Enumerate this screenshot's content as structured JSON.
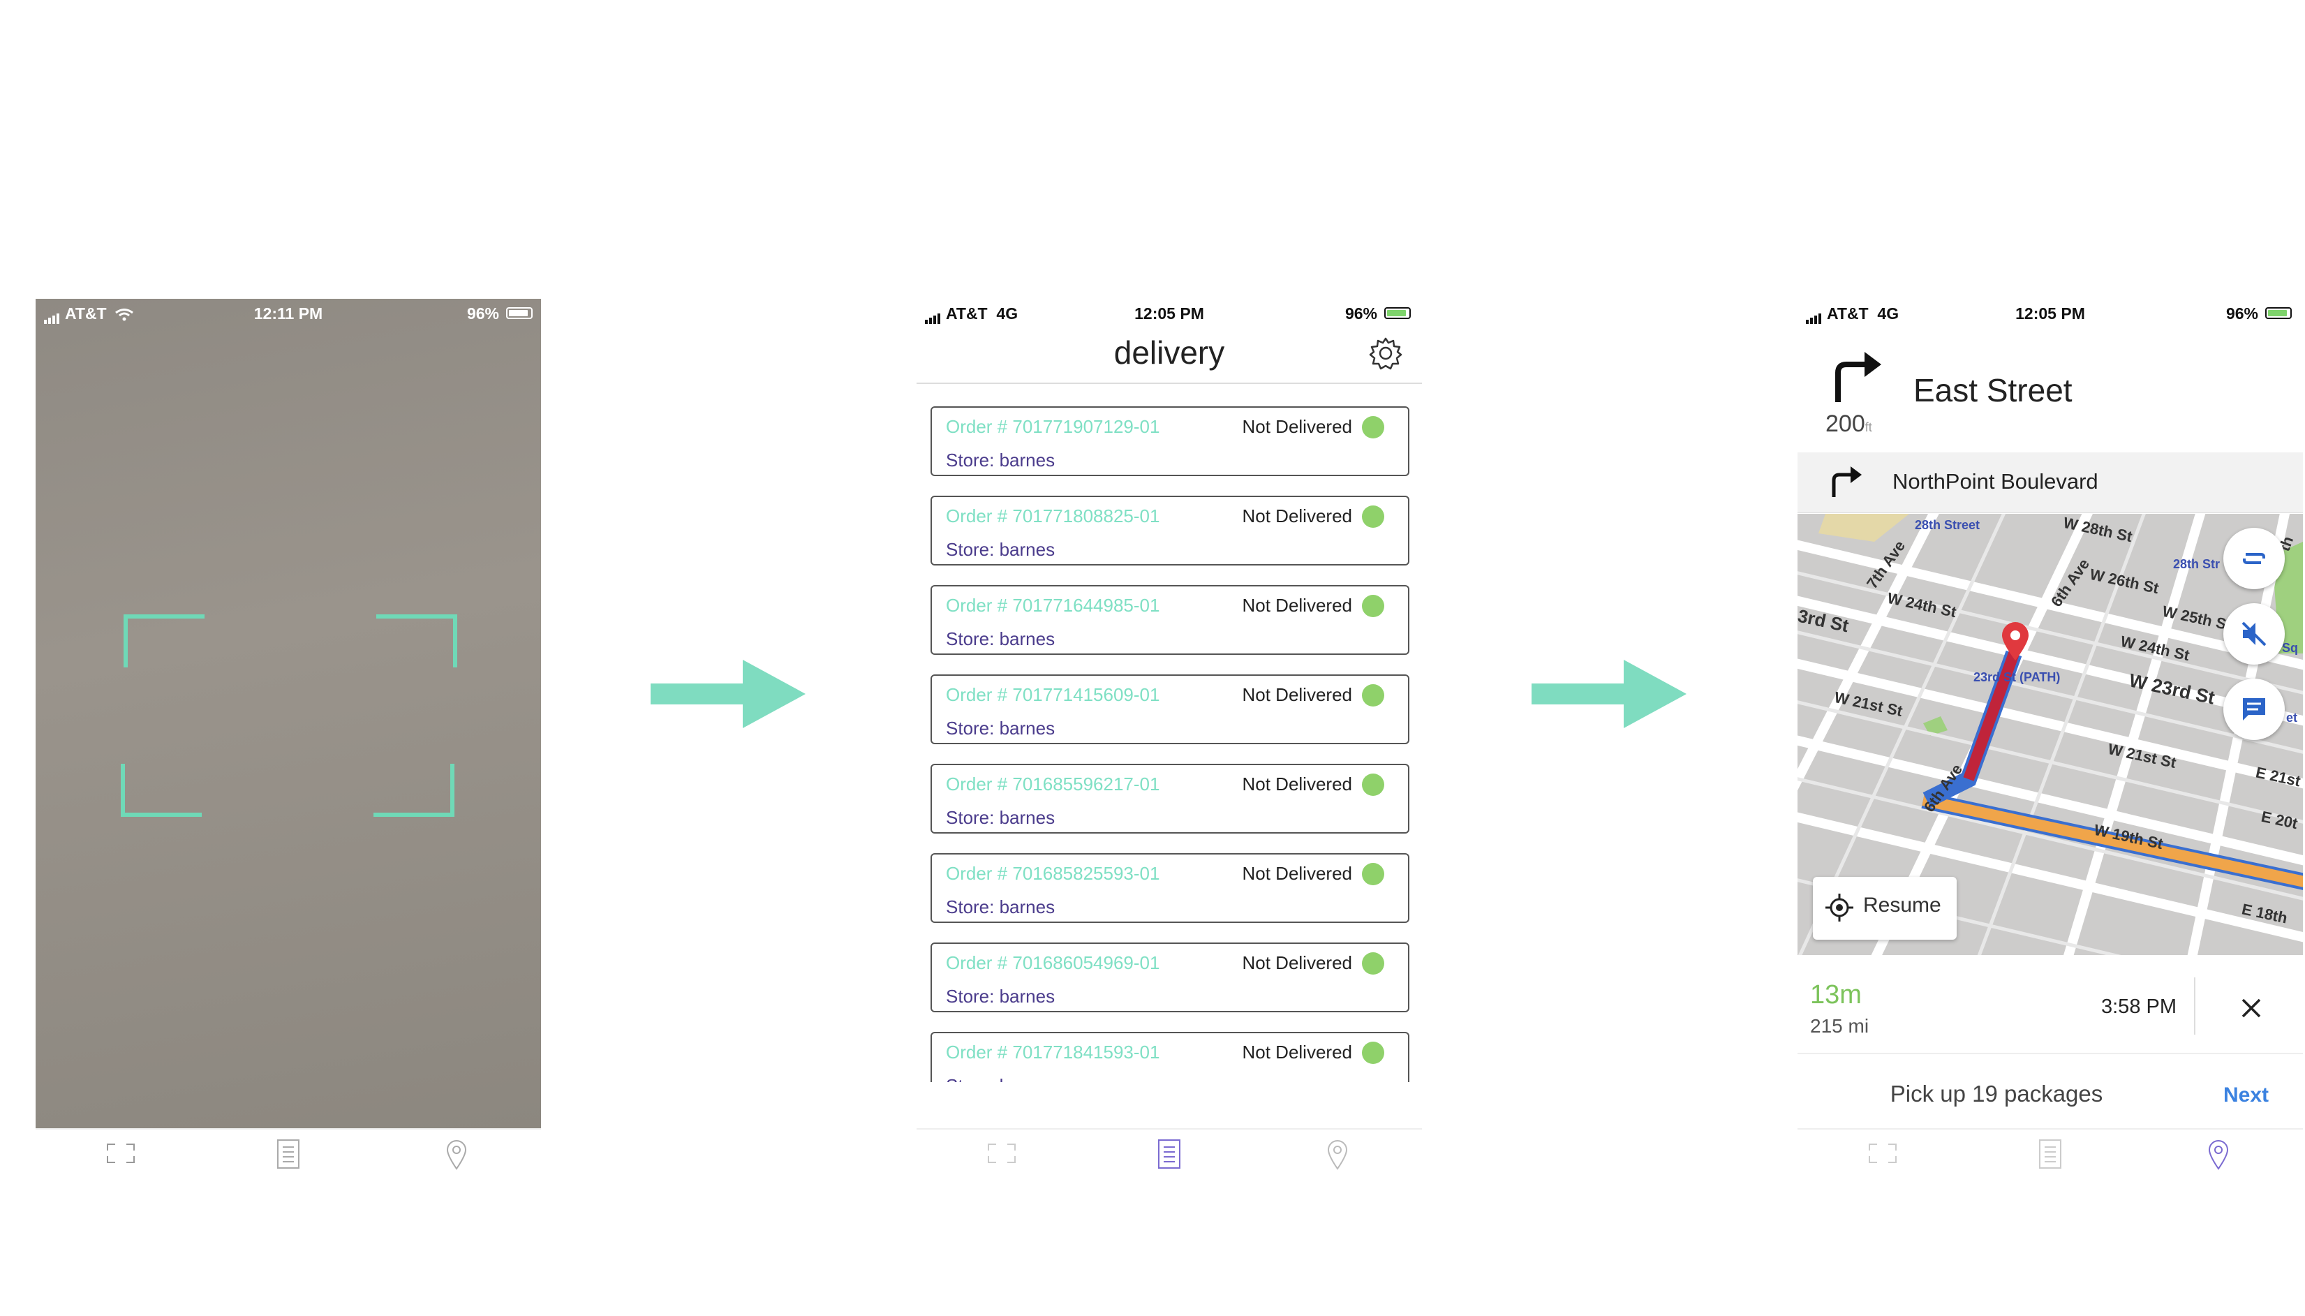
{
  "colors": {
    "accent": "#7fe0c4",
    "status_dot": "#8fd16a",
    "store": "#4b3c8c",
    "eta": "#7cc35b",
    "next": "#3b82e0",
    "tab_active": "#7b6bd1"
  },
  "screen1": {
    "status": {
      "carrier": "AT&T",
      "time": "12:11 PM",
      "battery": "96%"
    },
    "tabs": [
      "scan-icon",
      "list-icon",
      "location-pin-icon"
    ]
  },
  "screen2": {
    "status": {
      "carrier": "AT&T",
      "network": "4G",
      "time": "12:05 PM",
      "battery": "96%"
    },
    "title": "delivery",
    "orders": [
      {
        "number": "Order # 701771907129-01",
        "status": "Not Delivered",
        "store": "Store: barnes"
      },
      {
        "number": "Order # 701771808825-01",
        "status": "Not Delivered",
        "store": "Store: barnes"
      },
      {
        "number": "Order # 701771644985-01",
        "status": "Not Delivered",
        "store": "Store: barnes"
      },
      {
        "number": "Order # 701771415609-01",
        "status": "Not Delivered",
        "store": "Store: barnes"
      },
      {
        "number": "Order # 701685596217-01",
        "status": "Not Delivered",
        "store": "Store: barnes"
      },
      {
        "number": "Order # 701685825593-01",
        "status": "Not Delivered",
        "store": "Store: barnes"
      },
      {
        "number": "Order # 701686054969-01",
        "status": "Not Delivered",
        "store": "Store: barnes"
      },
      {
        "number": "Order # 701771841593-01",
        "status": "Not Delivered",
        "store": "Store: barnes"
      }
    ]
  },
  "screen3": {
    "status": {
      "carrier": "AT&T",
      "network": "4G",
      "time": "12:05 PM",
      "battery": "96%"
    },
    "turn_street": "East Street",
    "turn_distance": "200",
    "turn_unit": "ft",
    "next_street": "NorthPoint Boulevard",
    "map_labels": [
      "28th Street",
      "W 28th St",
      "7th Ave",
      "6th Ave",
      "W 26th St",
      "28th Str",
      "W 24th St",
      "W 25th S",
      "3rd St",
      "W 24th St",
      "23rd St (PATH)",
      "W 23rd St",
      "W 21st St",
      "W 21st St",
      "E 21st",
      "6th Ave",
      "E 20t",
      "W 19th St",
      "E 18th",
      "Sq",
      "et",
      "th"
    ],
    "resume_label": "Resume",
    "eta": "13m",
    "distance": "215 mi",
    "arrival": "3:58 PM",
    "pickup": "Pick up 19 packages",
    "next_label": "Next"
  }
}
